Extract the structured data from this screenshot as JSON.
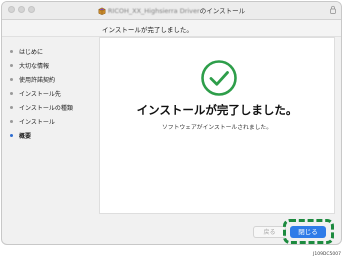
{
  "window": {
    "title_blurred": "RICOH_XX_Highsierra Driver",
    "title_suffix": "のインストール",
    "icons": {
      "package": "installer-package-icon",
      "lock": "lock-icon"
    },
    "traffic_lights": [
      "close",
      "minimize",
      "zoom"
    ]
  },
  "subheader": {
    "text": "インストールが完了しました。"
  },
  "sidebar": {
    "steps": [
      {
        "label": "はじめに",
        "active": false
      },
      {
        "label": "大切な情報",
        "active": false
      },
      {
        "label": "使用許諾契約",
        "active": false
      },
      {
        "label": "インストール先",
        "active": false
      },
      {
        "label": "インストールの種類",
        "active": false
      },
      {
        "label": "インストール",
        "active": false
      },
      {
        "label": "概要",
        "active": true
      }
    ]
  },
  "content": {
    "icon": "checkmark-circle-icon",
    "title": "インストールが完了しました。",
    "subtitle": "ソフトウェアがインストールされました。"
  },
  "buttons": {
    "back_label": "戻る",
    "close_label": "閉じる"
  },
  "figure_id": "J109DC5007",
  "colors": {
    "accent": "#2f7ce8",
    "check": "#2e9e4a",
    "highlight": "#1c8a3e",
    "active_dot": "#2f6dd0"
  }
}
